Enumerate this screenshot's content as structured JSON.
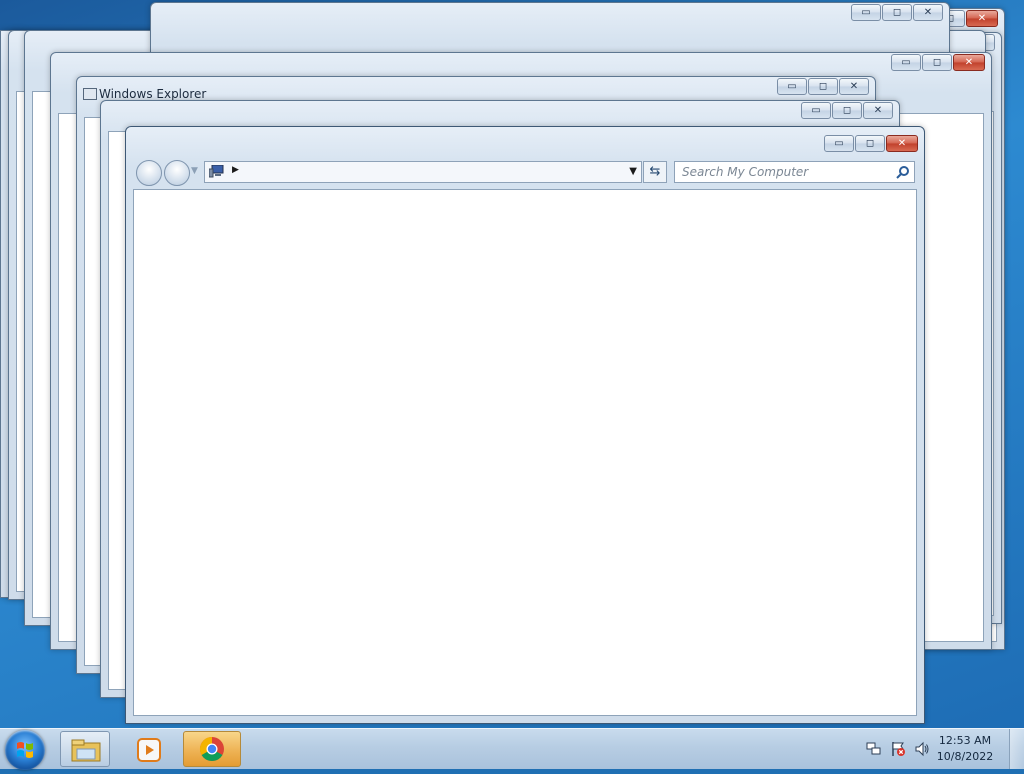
{
  "windows": {
    "title_label": "Windows Explorer",
    "minimize_glyph": "▭",
    "maximize_glyph": "◻",
    "close_glyph": "✕"
  },
  "explorer": {
    "search_placeholder": "Search My Computer",
    "address_path": ""
  },
  "taskbar": {
    "clock_time": "12:53 AM",
    "clock_date": "10/8/2022",
    "pinned": [
      {
        "icon": "file-explorer-icon"
      },
      {
        "icon": "media-player-icon"
      },
      {
        "icon": "chrome-icon"
      }
    ],
    "tray": [
      {
        "icon": "network-icon"
      },
      {
        "icon": "action-center-flag-icon"
      },
      {
        "icon": "volume-icon"
      }
    ]
  },
  "colors": {
    "close_red": "#c0402b",
    "active_taskbar": "#eeb355",
    "window_chrome": "#d5e2ef"
  }
}
